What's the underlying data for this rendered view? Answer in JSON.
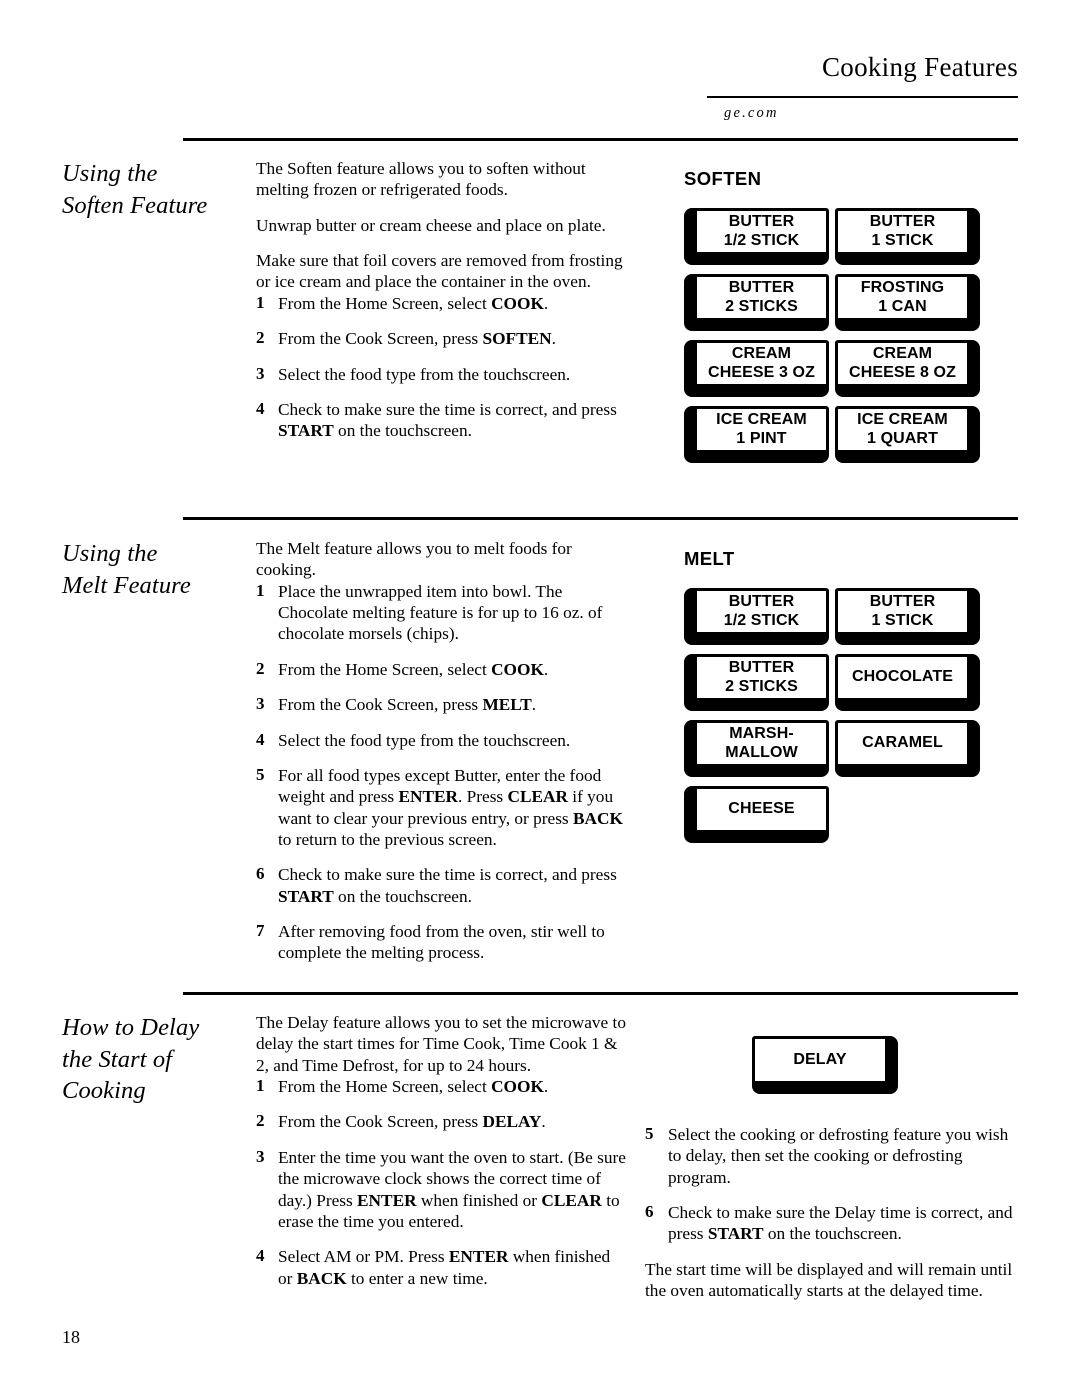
{
  "header": {
    "title": "Cooking Features",
    "site": "ge.com"
  },
  "page_number": "18",
  "sections": {
    "soften": {
      "heading_line1": "Using the",
      "heading_line2": "Soften Feature",
      "paragraphs": [
        "The Soften feature allows you to soften without melting frozen or refrigerated foods.",
        "Unwrap butter or cream cheese and place on plate.",
        "Make sure that foil covers are removed from frosting or ice cream and place the container in the oven."
      ],
      "steps": [
        {
          "num": "1",
          "parts": [
            {
              "t": "From the Home Screen, select "
            },
            {
              "t": "COOK",
              "b": true
            },
            {
              "t": "."
            }
          ]
        },
        {
          "num": "2",
          "parts": [
            {
              "t": "From the Cook Screen, press "
            },
            {
              "t": "SOFTEN",
              "b": true
            },
            {
              "t": "."
            }
          ]
        },
        {
          "num": "3",
          "parts": [
            {
              "t": "Select the food type from the touchscreen."
            }
          ]
        },
        {
          "num": "4",
          "parts": [
            {
              "t": "Check to make sure the time is correct, and press "
            },
            {
              "t": "START",
              "b": true
            },
            {
              "t": " on the touchscreen."
            }
          ]
        }
      ],
      "panel": {
        "title": "SOFTEN",
        "rows": [
          [
            {
              "label": "BUTTER\n1/2 STICK",
              "shadow": "left"
            },
            {
              "label": "BUTTER\n1 STICK",
              "shadow": "right"
            }
          ],
          [
            {
              "label": "BUTTER\n2 STICKS",
              "shadow": "left"
            },
            {
              "label": "FROSTING\n1 CAN",
              "shadow": "right"
            }
          ],
          [
            {
              "label": "CREAM\nCHEESE 3 OZ",
              "shadow": "left"
            },
            {
              "label": "CREAM\nCHEESE 8 OZ",
              "shadow": "right"
            }
          ],
          [
            {
              "label": "ICE CREAM\n1 PINT",
              "shadow": "left"
            },
            {
              "label": "ICE CREAM\n1 QUART",
              "shadow": "right"
            }
          ]
        ]
      }
    },
    "melt": {
      "heading_line1": "Using the",
      "heading_line2": "Melt Feature",
      "paragraphs": [
        "The Melt feature allows you to melt foods for cooking."
      ],
      "steps": [
        {
          "num": "1",
          "parts": [
            {
              "t": "Place the unwrapped item into bowl. The Chocolate melting feature is for up to 16 oz. of chocolate morsels (chips)."
            }
          ]
        },
        {
          "num": "2",
          "parts": [
            {
              "t": "From the Home Screen, select "
            },
            {
              "t": "COOK",
              "b": true
            },
            {
              "t": "."
            }
          ]
        },
        {
          "num": "3",
          "parts": [
            {
              "t": "From the Cook Screen, press "
            },
            {
              "t": "MELT",
              "b": true
            },
            {
              "t": "."
            }
          ]
        },
        {
          "num": "4",
          "parts": [
            {
              "t": "Select the food type from the touchscreen."
            }
          ]
        },
        {
          "num": "5",
          "parts": [
            {
              "t": "For all food types except Butter, enter the food weight and press "
            },
            {
              "t": "ENTER",
              "b": true
            },
            {
              "t": ". Press "
            },
            {
              "t": "CLEAR",
              "b": true
            },
            {
              "t": " if you want to clear your previous entry, or press "
            },
            {
              "t": "BACK",
              "b": true
            },
            {
              "t": " to return to the previous screen."
            }
          ]
        },
        {
          "num": "6",
          "parts": [
            {
              "t": "Check to make sure the time is correct, and press "
            },
            {
              "t": "START",
              "b": true
            },
            {
              "t": " on the touchscreen."
            }
          ]
        },
        {
          "num": "7",
          "parts": [
            {
              "t": "After removing food from the oven, stir well to complete the melting process."
            }
          ]
        }
      ],
      "panel": {
        "title": "MELT",
        "rows": [
          [
            {
              "label": "BUTTER\n1/2 STICK",
              "shadow": "left"
            },
            {
              "label": "BUTTER\n1 STICK",
              "shadow": "right"
            }
          ],
          [
            {
              "label": "BUTTER\n2 STICKS",
              "shadow": "left"
            },
            {
              "label": "CHOCOLATE",
              "shadow": "right"
            }
          ],
          [
            {
              "label": "MARSH-\nMALLOW",
              "shadow": "left"
            },
            {
              "label": "CARAMEL",
              "shadow": "right"
            }
          ],
          [
            {
              "label": "CHEESE",
              "shadow": "left"
            }
          ]
        ]
      }
    },
    "delay": {
      "heading_line1": "How to Delay",
      "heading_line2": "the Start of",
      "heading_line3": "Cooking",
      "paragraphs": [
        "The Delay feature allows you to set the microwave to delay the start times for Time Cook, Time Cook 1 & 2, and Time Defrost, for up to 24 hours."
      ],
      "steps_left": [
        {
          "num": "1",
          "parts": [
            {
              "t": "From the Home Screen, select "
            },
            {
              "t": "COOK",
              "b": true
            },
            {
              "t": "."
            }
          ]
        },
        {
          "num": "2",
          "parts": [
            {
              "t": "From the Cook Screen, press "
            },
            {
              "t": "DELAY",
              "b": true
            },
            {
              "t": "."
            }
          ]
        },
        {
          "num": "3",
          "parts": [
            {
              "t": "Enter the time you want the oven to start. (Be sure the microwave clock shows the correct time of day.) Press "
            },
            {
              "t": "ENTER",
              "b": true
            },
            {
              "t": " when finished or "
            },
            {
              "t": "CLEAR",
              "b": true
            },
            {
              "t": " to erase the time you entered."
            }
          ]
        },
        {
          "num": "4",
          "parts": [
            {
              "t": "Select AM or PM. Press "
            },
            {
              "t": "ENTER",
              "b": true
            },
            {
              "t": " when finished or "
            },
            {
              "t": "BACK",
              "b": true
            },
            {
              "t": " to enter a new time."
            }
          ]
        }
      ],
      "steps_right": [
        {
          "num": "5",
          "parts": [
            {
              "t": "Select the cooking or defrosting feature you wish to delay, then set the cooking or defrosting program."
            }
          ]
        },
        {
          "num": "6",
          "parts": [
            {
              "t": "Check to make sure the Delay time is correct, and press "
            },
            {
              "t": "START",
              "b": true
            },
            {
              "t": " on the touchscreen."
            }
          ]
        }
      ],
      "closing_paragraph": "The start time will be displayed and will remain until the oven automatically starts at the delayed time.",
      "panel": {
        "key": {
          "label": "DELAY",
          "shadow": "right"
        }
      }
    }
  }
}
